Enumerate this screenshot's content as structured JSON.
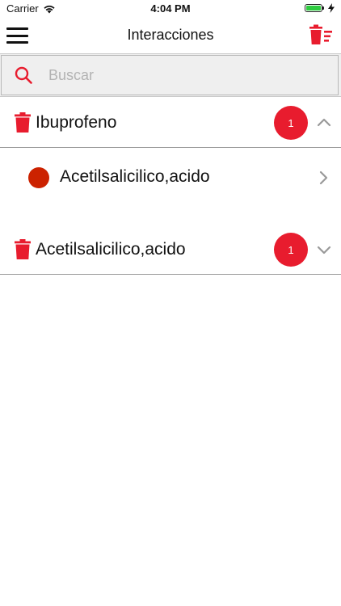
{
  "status_bar": {
    "carrier": "Carrier",
    "time": "4:04 PM",
    "battery_level": 1.0,
    "icons": [
      "wifi-icon",
      "battery-icon",
      "charging-icon"
    ]
  },
  "nav": {
    "title": "Interacciones",
    "left_icon": "hamburger-menu-icon",
    "right_icon": "trash-sort-icon"
  },
  "search": {
    "placeholder": "Buscar",
    "value": "",
    "icon": "search-icon"
  },
  "groups": [
    {
      "label": "Ibuprofeno",
      "count": "1",
      "expanded": true,
      "interactions": [
        {
          "label": "Acetilsalicilico,acido",
          "severity_color": "#cc2200"
        }
      ]
    },
    {
      "label": "Acetilsalicilico,acido",
      "count": "1",
      "expanded": false,
      "interactions": []
    }
  ],
  "colors": {
    "accent": "#e81c2e",
    "severity": "#cc2200",
    "chevron": "#999999",
    "search_bg": "#efefef"
  }
}
